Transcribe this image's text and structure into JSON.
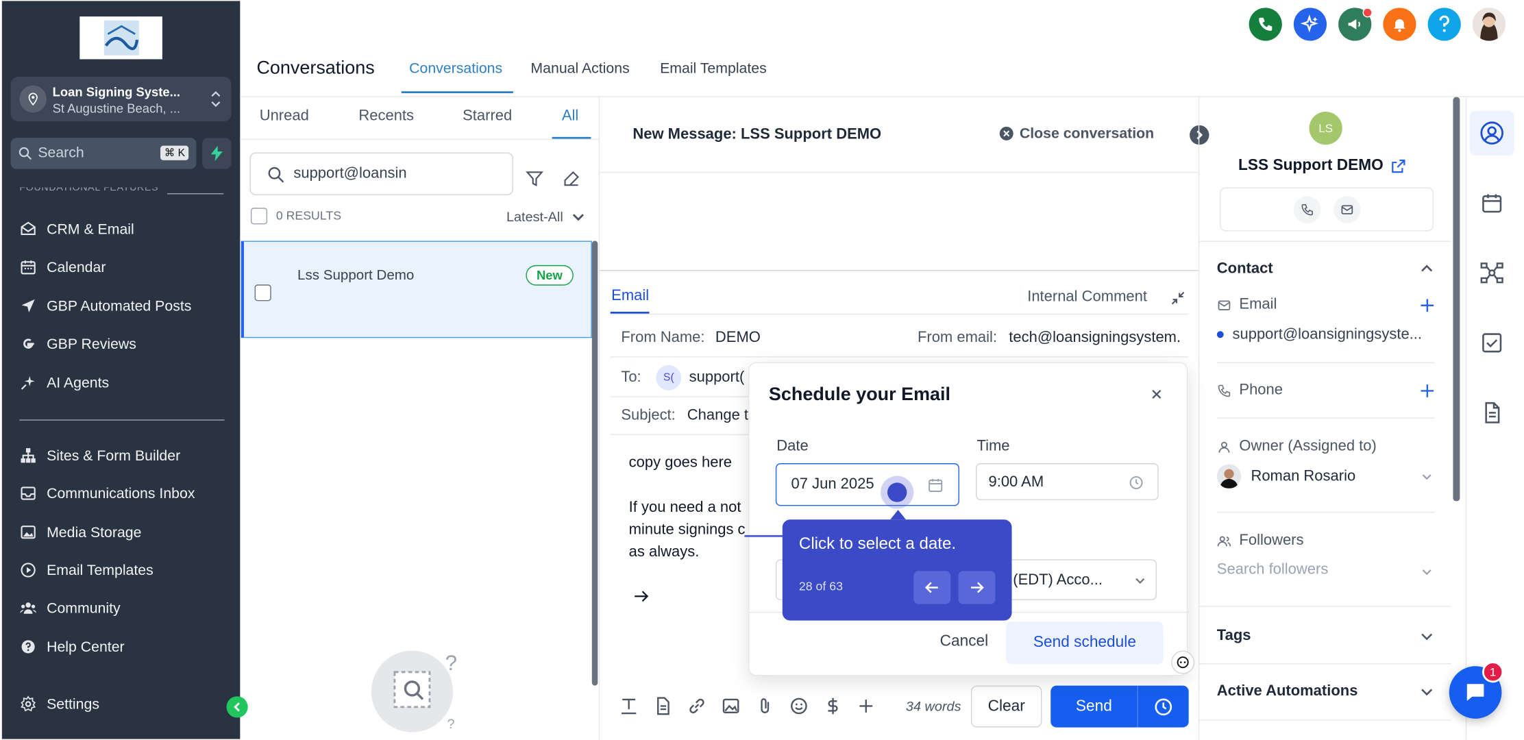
{
  "sidebar": {
    "account_name": "Loan Signing Syste...",
    "account_location": "St Augustine Beach, ...",
    "search_placeholder": "Search",
    "search_shortcut": "⌘ K",
    "section_label": "FOUNDATIONAL FEATURES",
    "items": [
      {
        "label": "CRM & Email",
        "icon": "mail-icon"
      },
      {
        "label": "Calendar",
        "icon": "calendar-icon"
      },
      {
        "label": "GBP Automated Posts",
        "icon": "send-icon"
      },
      {
        "label": "GBP Reviews",
        "icon": "google-icon"
      },
      {
        "label": "AI Agents",
        "icon": "sparkle-icon"
      },
      {
        "label": "Sites & Form Builder",
        "icon": "sitemap-icon"
      },
      {
        "label": "Communications Inbox",
        "icon": "inbox-icon"
      },
      {
        "label": "Media Storage",
        "icon": "image-icon"
      },
      {
        "label": "Email Templates",
        "icon": "play-icon"
      },
      {
        "label": "Community",
        "icon": "users-icon"
      },
      {
        "label": "Help Center",
        "icon": "help-icon"
      },
      {
        "label": "Settings",
        "icon": "gear-icon"
      }
    ]
  },
  "header": {
    "title": "Conversations",
    "tabs": [
      "Conversations",
      "Manual Actions",
      "Email Templates"
    ],
    "active_tab": "Conversations",
    "notification_badge_color": "#ef4444"
  },
  "list": {
    "filters": [
      "Unread",
      "Recents",
      "Starred",
      "All"
    ],
    "active_filter": "All",
    "search_value": "support@loansin",
    "results": "0 RESULTS",
    "sort": "Latest-All",
    "items": [
      {
        "name": "Lss Support Demo",
        "badge": "New"
      }
    ]
  },
  "conversation": {
    "title": "New Message: LSS Support DEMO",
    "close_label": "Close conversation",
    "tabs": [
      "Email",
      "Internal Comment"
    ],
    "from_name_label": "From Name:",
    "from_name_value": "DEMO",
    "from_email_label": "From email:",
    "from_email_value": "tech@loansigningsystem.",
    "to_label": "To:",
    "to_avatar": "S(",
    "to_value": "support(",
    "subject_label": "Subject:",
    "subject_value": "Change t",
    "body_line1": "copy goes here",
    "body_line2": "If you need a not",
    "body_line3": "minute signings c",
    "body_line4": "as always.",
    "words": "34 words",
    "clear_label": "Clear",
    "send_label": "Send"
  },
  "schedule_modal": {
    "title": "Schedule your Email",
    "date_label": "Date",
    "date_value": "07 Jun 2025",
    "time_label": "Time",
    "time_value": "9:00 AM",
    "timezone_value": "rk (EDT) Acco...",
    "cancel_label": "Cancel",
    "submit_label": "Send schedule"
  },
  "tour": {
    "text": "Click to select a date.",
    "progress": "28 of 63"
  },
  "contact": {
    "initials": "LS",
    "name": "LSS Support DEMO",
    "section_contact": "Contact",
    "email_label": "Email",
    "email_value": "support@loansigningsyste...",
    "phone_label": "Phone",
    "owner_label": "Owner (Assigned to)",
    "owner_value": "Roman Rosario",
    "followers_label": "Followers",
    "followers_placeholder": "Search followers",
    "tags_label": "Tags",
    "automations_label": "Active Automations"
  },
  "chat_badge": "1",
  "colors": {
    "accent": "#155eef",
    "sidebar_bg": "#2a3342",
    "tour_bg": "#3b4bc8",
    "new_badge": "#16a34a"
  }
}
